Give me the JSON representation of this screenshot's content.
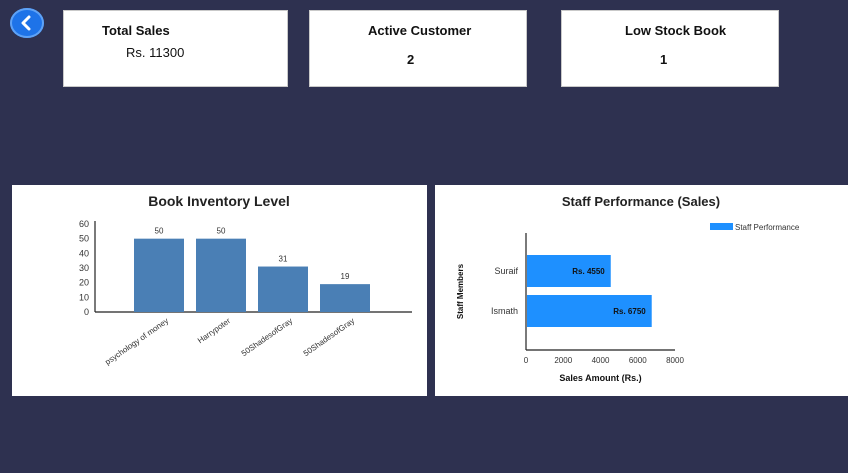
{
  "back_button": {
    "icon": "chevron-left-icon",
    "color": "#1e73e8"
  },
  "cards": [
    {
      "title": "Total Sales",
      "value": "Rs. 11300"
    },
    {
      "title": "Active Customer",
      "value": "2"
    },
    {
      "title": "Low Stock Book",
      "value": "1"
    }
  ],
  "chart_data": [
    {
      "type": "bar",
      "title": "Book Inventory Level",
      "categories": [
        "psychology of money",
        "Harrypoter",
        "50ShadesofGray",
        "50ShadesofGray"
      ],
      "values": [
        50,
        50,
        31,
        19
      ],
      "data_labels": [
        "50",
        "50",
        "31",
        "19"
      ],
      "y_ticks": [
        "0",
        "10",
        "20",
        "30",
        "40",
        "50",
        "60"
      ],
      "ylim": [
        0,
        60
      ],
      "color": "#4a7fb5"
    },
    {
      "type": "bar",
      "orientation": "horizontal",
      "title": "Staff Performance (Sales)",
      "categories": [
        "Suraif",
        "Ismath"
      ],
      "values": [
        4550,
        6750
      ],
      "data_labels": [
        "Rs. 4550",
        "Rs. 6750"
      ],
      "series": [
        {
          "name": "Staff Performance",
          "values": [
            4550,
            6750
          ]
        }
      ],
      "xlabel": "Sales Amount (Rs.)",
      "ylabel": "Staff Members",
      "x_ticks": [
        "0",
        "2000",
        "4000",
        "6000",
        "8000"
      ],
      "xlim": [
        0,
        8000
      ],
      "legend": "top-right",
      "color": "#1e90ff"
    }
  ]
}
